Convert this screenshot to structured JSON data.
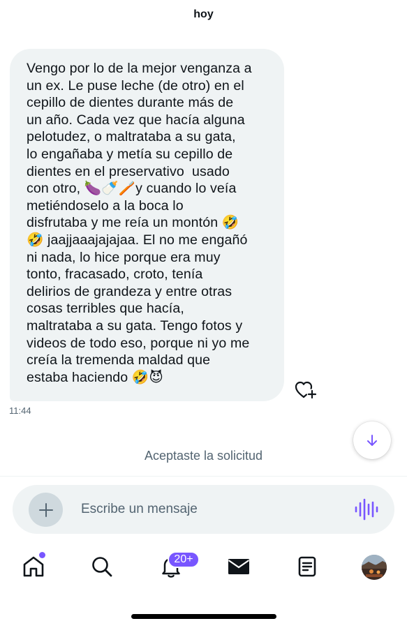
{
  "header": {
    "date": "hoy"
  },
  "message": {
    "text": "Vengo por lo de la mejor venganza a\nun ex. Le puse leche (de otro) en el\ncepillo de dientes durante más de\nun año. Cada vez que hacía alguna\npelotudez, o maltrataba a su gata,\nlo engañaba y metía su cepillo de\ndientes en el preservativo  usado\ncon otro, 🍆🍼🪥y cuando lo veía\nmetiéndoselo a la boca lo\ndisfrutaba y me reía un montón 🤣\n🤣 jaajjaaajajajaa. El no me engañó\nni nada, lo hice porque era muy\ntonto, fracasado, croto, tenía\ndelirios de grandeza y entre otras\ncosas terribles que hacía,\nmaltrataba a su gata. Tengo fotos y\nvideos de todo eso, porque ni yo me\ncreía la tremenda maldad que\nestaba haciendo 🤣😈",
    "timestamp": "11:44",
    "react_icon": "heart-plus-icon"
  },
  "system_note": "Aceptaste la solicitud",
  "composer": {
    "placeholder": "Escribe un mensaje",
    "add_icon": "plus-icon",
    "voice_icon": "voice-wave-icon"
  },
  "tabbar": {
    "items": [
      {
        "name": "home",
        "icon": "home-icon"
      },
      {
        "name": "search",
        "icon": "search-icon"
      },
      {
        "name": "notifications",
        "icon": "bell-icon"
      },
      {
        "name": "messages",
        "icon": "envelope-icon"
      },
      {
        "name": "lists",
        "icon": "document-icon"
      },
      {
        "name": "profile",
        "icon": "avatar"
      }
    ],
    "notifications_badge": "20+"
  },
  "colors": {
    "accent": "#7856ff",
    "bubble_bg": "#eff3f4",
    "secondary_text": "#536471",
    "primary_text": "#0f1419"
  }
}
